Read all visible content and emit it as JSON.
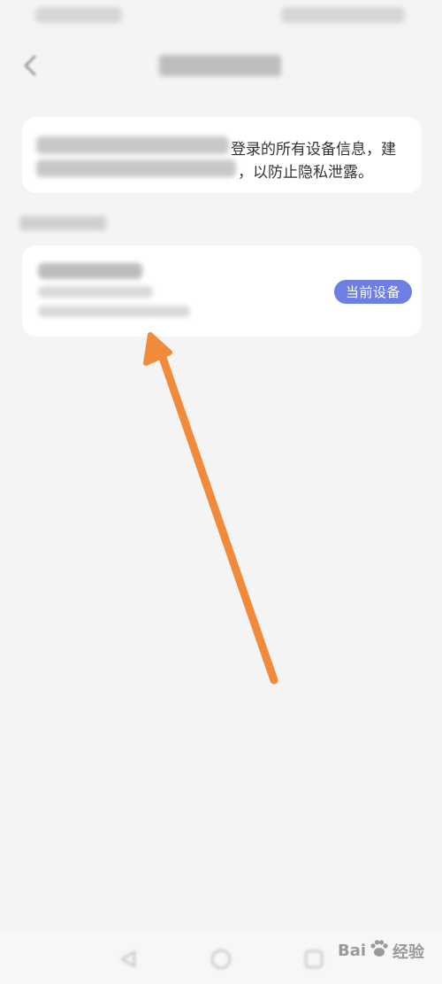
{
  "info_card": {
    "line1_visible": "登录的所有设备信息，建",
    "line2_visible": "，以防止隐私泄露。"
  },
  "device": {
    "badge_label": "当前设备"
  },
  "watermark": {
    "brand_left": "Bai",
    "brand_right": "经验"
  },
  "icons": {
    "back": "chevron-left-icon",
    "nav_back": "triangle-back-icon",
    "nav_home": "circle-home-icon",
    "nav_recent": "square-recent-icon",
    "arrow": "arrow-up-left-icon"
  },
  "colors": {
    "badge_bg": "#6e7fe3",
    "arrow": "#f18a3b",
    "background": "#f4f4f4"
  }
}
